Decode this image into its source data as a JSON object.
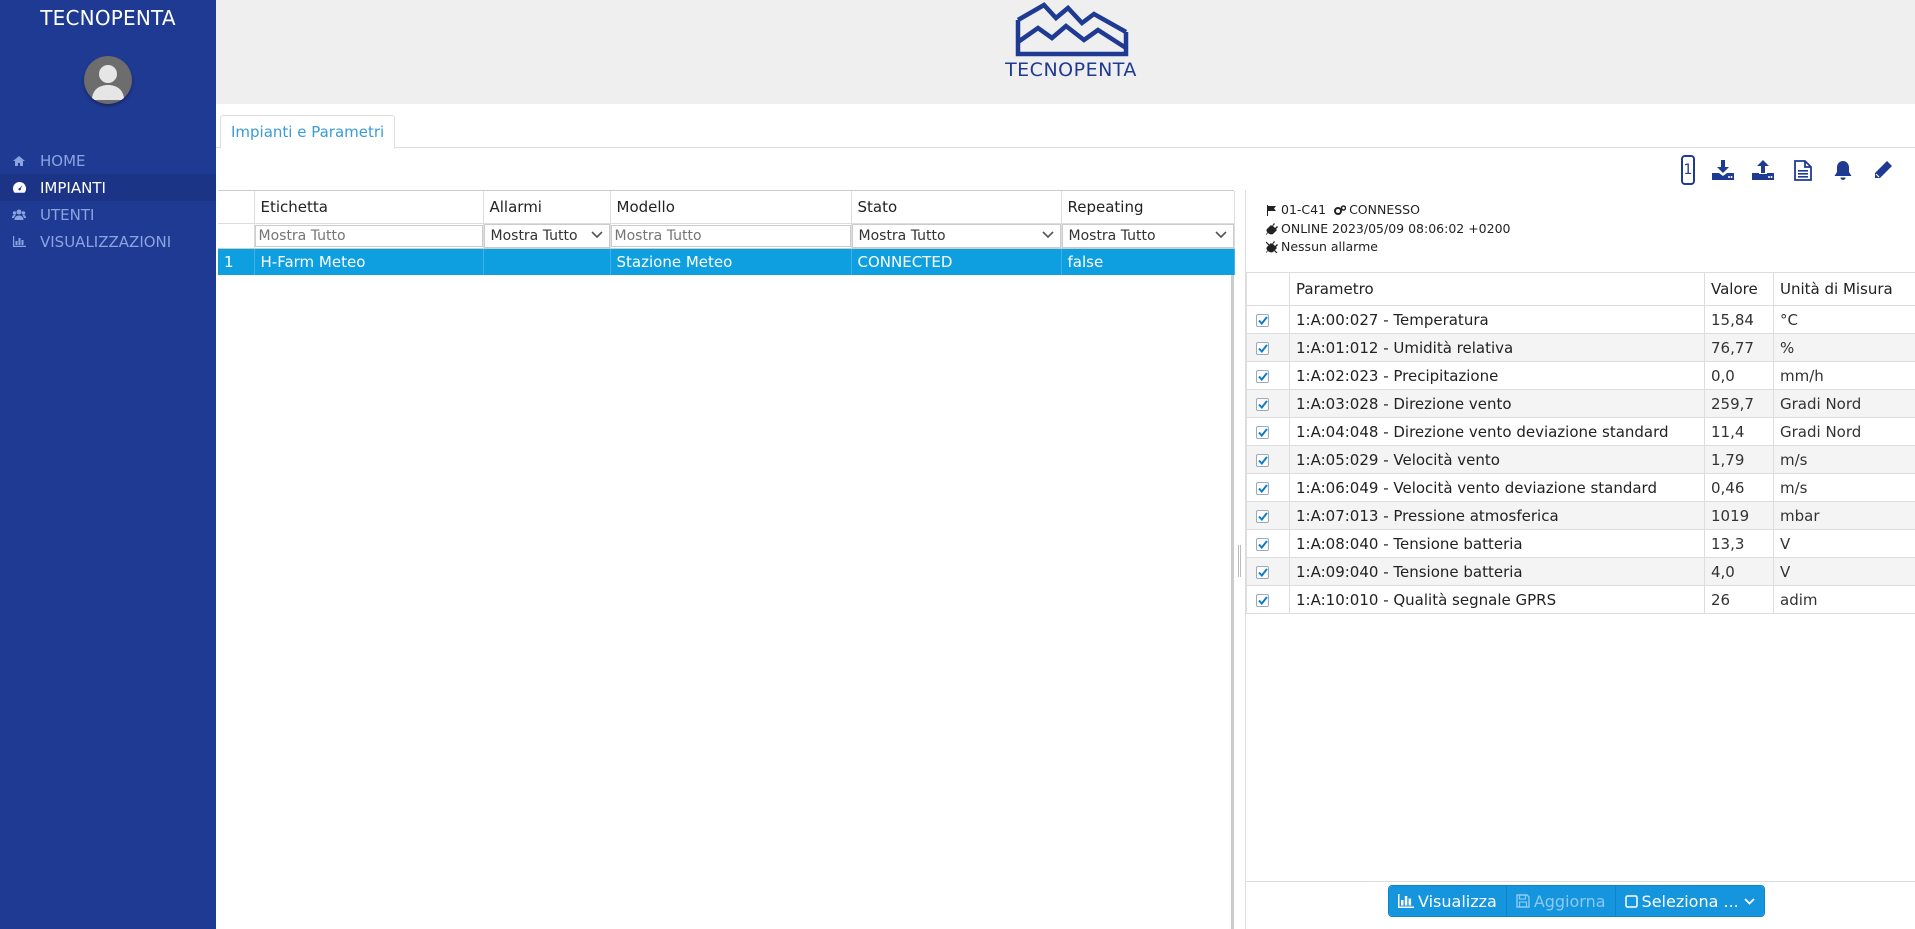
{
  "sidebar": {
    "brand": "TECNOPENTA",
    "items": [
      {
        "label": "HOME",
        "icon": "home-icon"
      },
      {
        "label": "IMPIANTI",
        "icon": "dashboard-icon",
        "active": true
      },
      {
        "label": "UTENTI",
        "icon": "users-icon"
      },
      {
        "label": "VISUALIZZAZIONI",
        "icon": "bar-chart-icon"
      }
    ]
  },
  "header": {
    "logo_text": "TECNOPENTA"
  },
  "tabs": [
    {
      "label": "Impianti e Parametri"
    }
  ],
  "toolbar": {
    "page_number": "1"
  },
  "grid": {
    "columns": [
      "",
      "Etichetta",
      "Allarmi",
      "Modello",
      "Stato",
      "Repeating"
    ],
    "filters": {
      "etichetta_placeholder": "Mostra Tutto",
      "allarmi_value": "Mostra Tutto",
      "modello_placeholder": "Mostra Tutto",
      "stato_value": "Mostra Tutto",
      "repeating_value": "Mostra Tutto"
    },
    "rows": [
      {
        "num": "1",
        "etichetta": "H-Farm Meteo",
        "allarmi": "",
        "modello": "Stazione Meteo",
        "stato": "CONNECTED",
        "repeating": "false"
      }
    ]
  },
  "detail": {
    "code": "01-C41",
    "status": "CONNESSO",
    "online": "ONLINE 2023/05/09 08:06:02 +0200",
    "alarms": "Nessun allarme"
  },
  "params": {
    "columns": [
      "",
      "Parametro",
      "Valore",
      "Unità di Misura"
    ],
    "rows": [
      {
        "name": "1:A:00:027 - Temperatura",
        "value": "15,84",
        "unit": "°C"
      },
      {
        "name": "1:A:01:012 - Umidità relativa",
        "value": "76,77",
        "unit": "%"
      },
      {
        "name": "1:A:02:023 - Precipitazione",
        "value": "0,0",
        "unit": "mm/h"
      },
      {
        "name": "1:A:03:028 - Direzione vento",
        "value": "259,7",
        "unit": "Gradi Nord"
      },
      {
        "name": "1:A:04:048 - Direzione vento deviazione standard",
        "value": "11,4",
        "unit": "Gradi Nord"
      },
      {
        "name": "1:A:05:029 - Velocità vento",
        "value": "1,79",
        "unit": "m/s"
      },
      {
        "name": "1:A:06:049 - Velocità vento deviazione standard",
        "value": "0,46",
        "unit": "m/s"
      },
      {
        "name": "1:A:07:013 - Pressione atmosferica",
        "value": "1019",
        "unit": "mbar"
      },
      {
        "name": "1:A:08:040 - Tensione batteria",
        "value": "13,3",
        "unit": "V"
      },
      {
        "name": "1:A:09:040 - Tensione batteria",
        "value": "4,0",
        "unit": "V"
      },
      {
        "name": "1:A:10:010 - Qualità segnale GPRS",
        "value": "26",
        "unit": "adim"
      }
    ]
  },
  "actions": {
    "visualizza": "Visualizza",
    "aggiorna": "Aggiorna",
    "seleziona": "Seleziona ..."
  },
  "colors": {
    "sidebar": "#1f3a93",
    "accent": "#1495de",
    "selected_row": "#0e9fe0"
  }
}
